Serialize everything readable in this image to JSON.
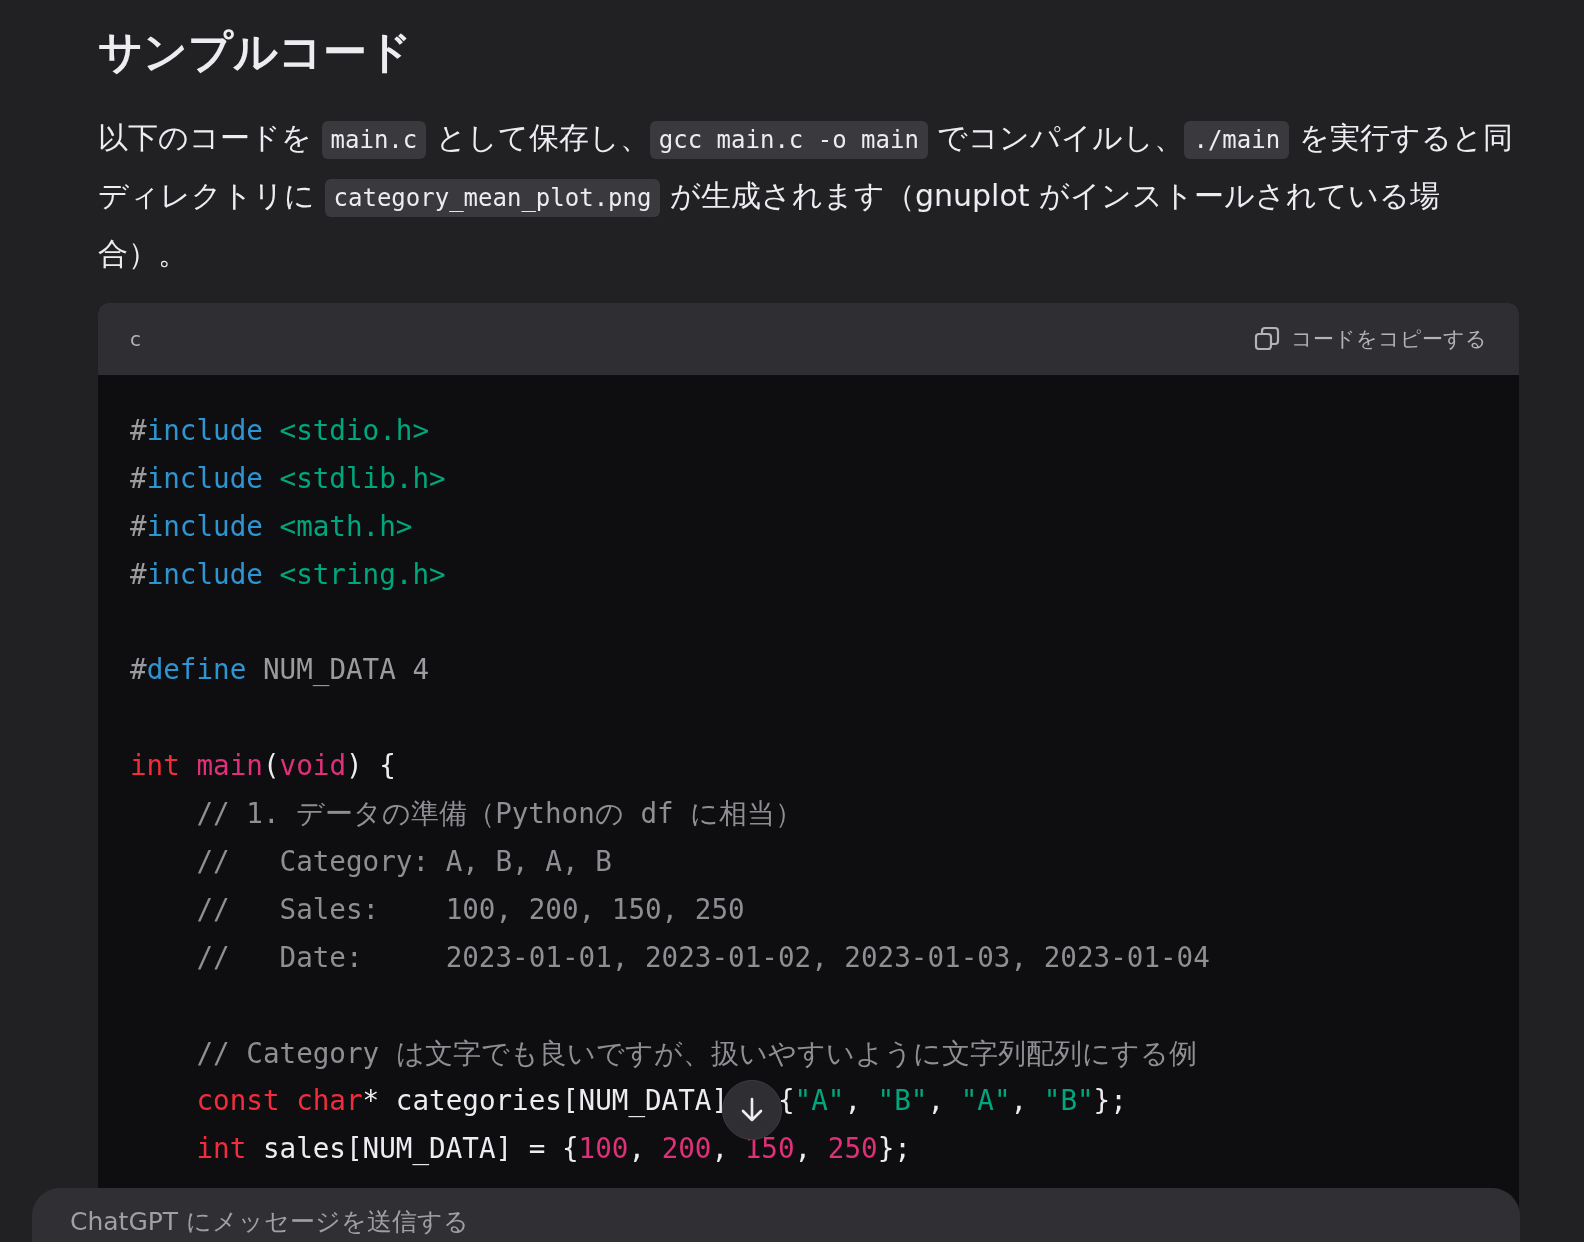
{
  "heading": "サンプルコード",
  "paragraph": [
    {
      "kind": "text",
      "text": "以下のコードを "
    },
    {
      "kind": "code",
      "text": "main.c"
    },
    {
      "kind": "text",
      "text": " として保存し、"
    },
    {
      "kind": "code",
      "text": "gcc main.c -o main"
    },
    {
      "kind": "text",
      "text": " でコンパイルし、"
    },
    {
      "kind": "code",
      "text": "./main"
    },
    {
      "kind": "text",
      "text": " を実行すると同ディレクトリに "
    },
    {
      "kind": "code",
      "text": "category_mean_plot.png"
    },
    {
      "kind": "text",
      "text": " が生成されます（gnuplot がインストールされている場合）。"
    }
  ],
  "code_block": {
    "language": "c",
    "copy_label": "コードをコピーする",
    "lines": [
      {
        "kind": "code",
        "tokens": [
          {
            "kind": "punct",
            "text": "#"
          },
          {
            "kind": "directive",
            "text": "include"
          },
          {
            "kind": "header",
            "text": " <stdio.h>"
          }
        ]
      },
      {
        "kind": "code",
        "tokens": [
          {
            "kind": "punct",
            "text": "#"
          },
          {
            "kind": "directive",
            "text": "include"
          },
          {
            "kind": "header",
            "text": " <stdlib.h>"
          }
        ]
      },
      {
        "kind": "code",
        "tokens": [
          {
            "kind": "punct",
            "text": "#"
          },
          {
            "kind": "directive",
            "text": "include"
          },
          {
            "kind": "header",
            "text": " <math.h>"
          }
        ]
      },
      {
        "kind": "code",
        "tokens": [
          {
            "kind": "punct",
            "text": "#"
          },
          {
            "kind": "directive",
            "text": "include"
          },
          {
            "kind": "header",
            "text": " <string.h>"
          }
        ]
      },
      {
        "kind": "blank"
      },
      {
        "kind": "code",
        "tokens": [
          {
            "kind": "punct",
            "text": "#"
          },
          {
            "kind": "directive",
            "text": "define"
          },
          {
            "kind": "punct",
            "text": " NUM_DATA 4"
          }
        ]
      },
      {
        "kind": "blank"
      },
      {
        "kind": "code",
        "tokens": [
          {
            "kind": "keyword",
            "text": "int"
          },
          {
            "kind": "function",
            "text": " main"
          },
          {
            "kind": "plain",
            "text": "("
          },
          {
            "kind": "function",
            "text": "void"
          },
          {
            "kind": "plain",
            "text": ") {"
          }
        ]
      },
      {
        "kind": "code",
        "tokens": [
          {
            "kind": "comment",
            "text": "    // 1. データの準備（Pythonの df に相当）"
          }
        ]
      },
      {
        "kind": "code",
        "tokens": [
          {
            "kind": "comment",
            "text": "    //   Category: A, B, A, B"
          }
        ]
      },
      {
        "kind": "code",
        "tokens": [
          {
            "kind": "comment",
            "text": "    //   Sales:    100, 200, 150, 250"
          }
        ]
      },
      {
        "kind": "code",
        "tokens": [
          {
            "kind": "comment",
            "text": "    //   Date:     2023-01-01, 2023-01-02, 2023-01-03, 2023-01-04"
          }
        ]
      },
      {
        "kind": "blank"
      },
      {
        "kind": "code",
        "tokens": [
          {
            "kind": "comment",
            "text": "    // Category は文字でも良いですが、扱いやすいように文字列配列にする例"
          }
        ]
      },
      {
        "kind": "code",
        "tokens": [
          {
            "kind": "keyword",
            "text": "    const"
          },
          {
            "kind": "keyword",
            "text": " char"
          },
          {
            "kind": "plain",
            "text": "* categories[NUM_DATA]"
          },
          {
            "kind": "gap"
          },
          {
            "kind": "plain",
            "text": " {"
          },
          {
            "kind": "string",
            "text": "\"A\""
          },
          {
            "kind": "plain",
            "text": ", "
          },
          {
            "kind": "string",
            "text": "\"B\""
          },
          {
            "kind": "plain",
            "text": ", "
          },
          {
            "kind": "string",
            "text": "\"A\""
          },
          {
            "kind": "plain",
            "text": ", "
          },
          {
            "kind": "string",
            "text": "\"B\""
          },
          {
            "kind": "plain",
            "text": "};"
          }
        ]
      },
      {
        "kind": "code",
        "tokens": [
          {
            "kind": "keyword",
            "text": "    int"
          },
          {
            "kind": "plain",
            "text": " sales[NUM_DATA] = {"
          },
          {
            "kind": "number",
            "text": "100"
          },
          {
            "kind": "plain",
            "text": ", "
          },
          {
            "kind": "number",
            "text": "200"
          },
          {
            "kind": "plain",
            "text": ", "
          },
          {
            "kind": "number",
            "text": "150"
          },
          {
            "kind": "plain",
            "text": ", "
          },
          {
            "kind": "number",
            "text": "250"
          },
          {
            "kind": "plain",
            "text": "};"
          }
        ]
      }
    ]
  },
  "composer": {
    "placeholder": "ChatGPT にメッセージを送信する"
  }
}
